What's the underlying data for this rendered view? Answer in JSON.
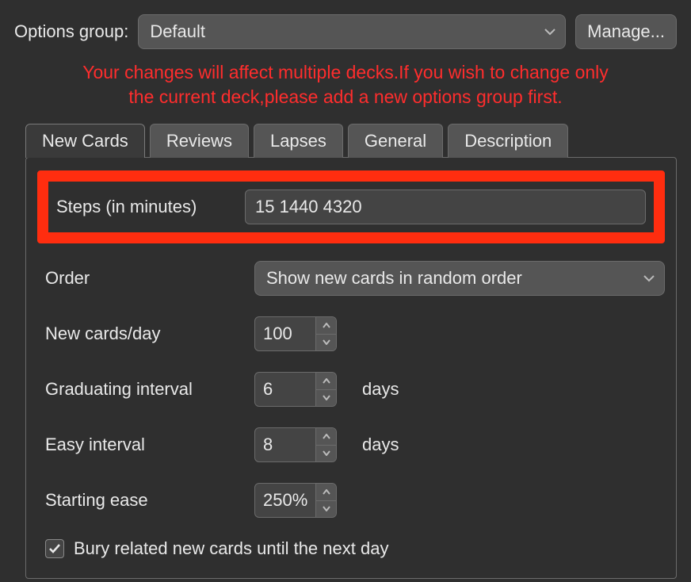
{
  "header": {
    "options_group_label": "Options group:",
    "options_group_selected": "Default",
    "manage_label": "Manage..."
  },
  "warning": {
    "line1": "Your changes will affect multiple decks.If you wish to change only",
    "line2": "the current deck,please add a new options group first."
  },
  "tabs": {
    "new_cards": "New Cards",
    "reviews": "Reviews",
    "lapses": "Lapses",
    "general": "General",
    "description": "Description"
  },
  "form": {
    "steps_label": "Steps (in minutes)",
    "steps_value": "15 1440 4320",
    "order_label": "Order",
    "order_value": "Show new cards in random order",
    "new_per_day_label": "New cards/day",
    "new_per_day_value": "100",
    "graduating_label": "Graduating interval",
    "graduating_value": "6",
    "easy_label": "Easy interval",
    "easy_value": "8",
    "days_unit": "days",
    "starting_ease_label": "Starting ease",
    "starting_ease_value": "250%",
    "bury_label": "Bury related new cards until the next day",
    "bury_checked": true
  }
}
